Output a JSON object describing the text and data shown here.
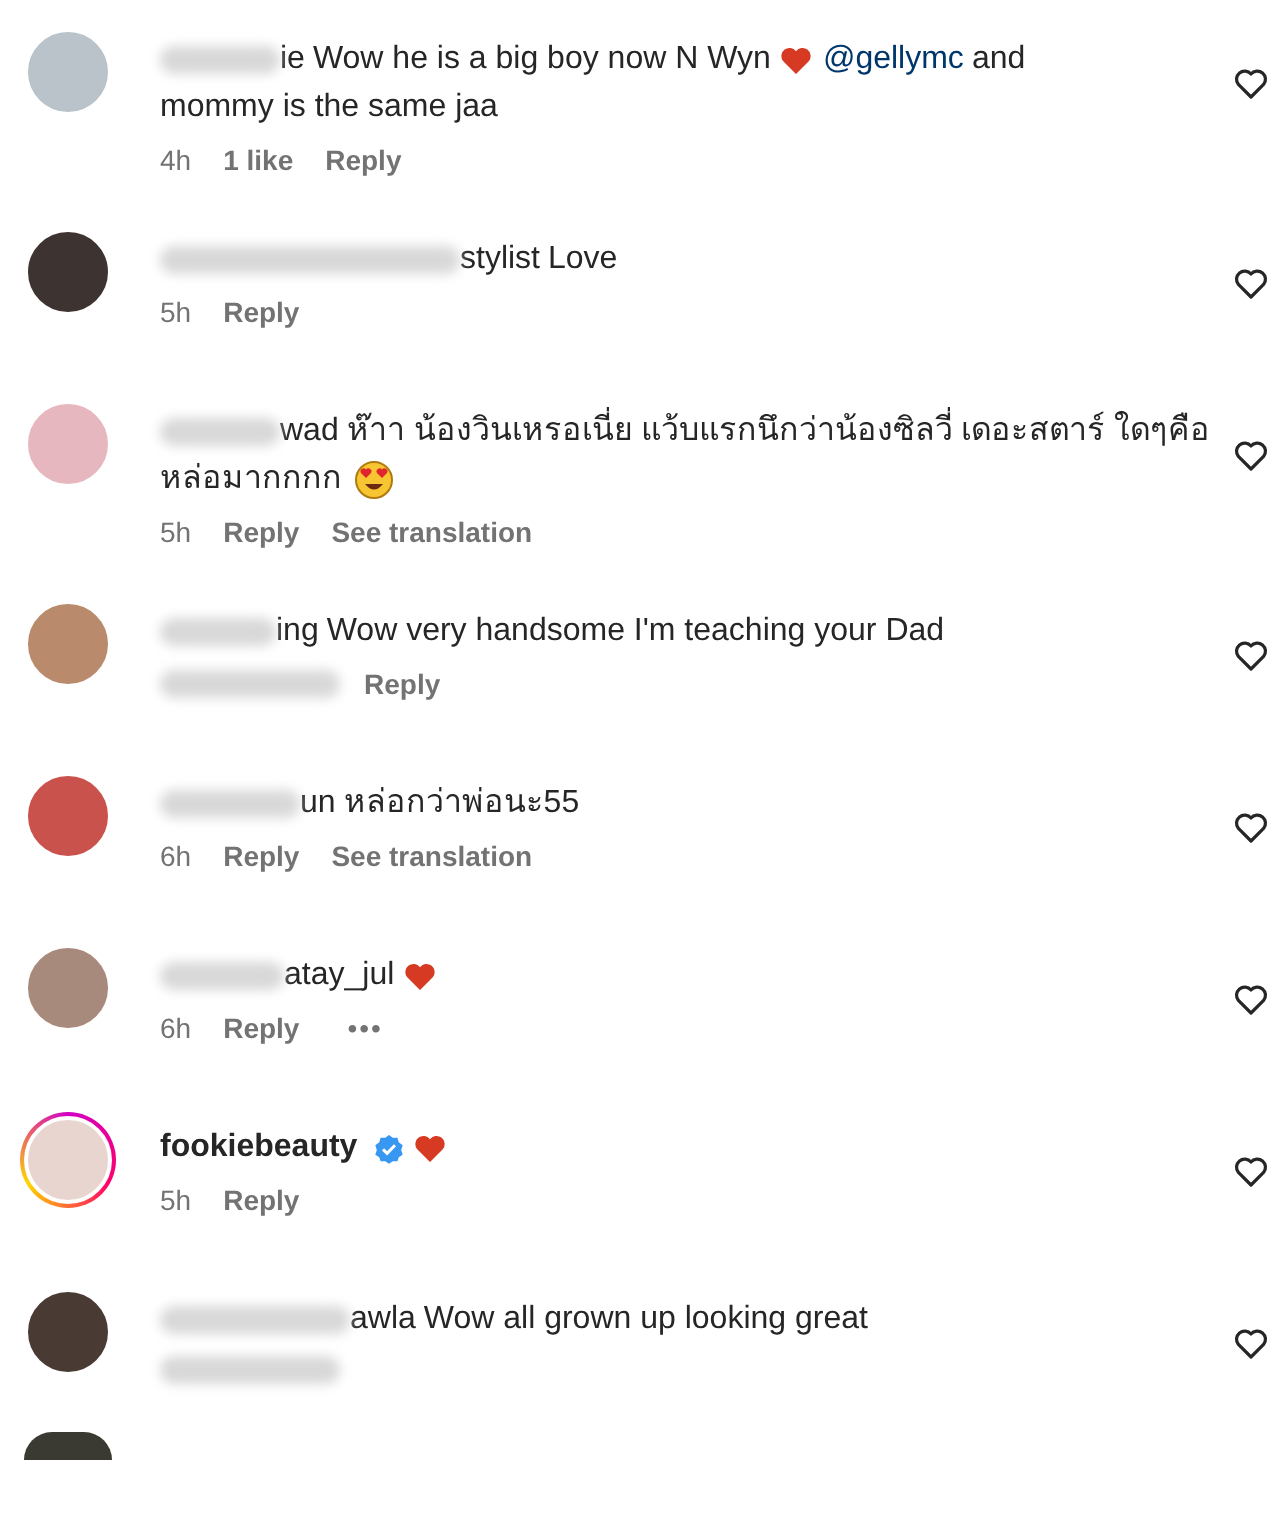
{
  "comments": [
    {
      "avatar": {
        "color": "#b9c3c9",
        "story_ring": false
      },
      "username": "ie",
      "username_blurred": true,
      "verified": false,
      "segments": [
        {
          "kind": "text",
          "text": "Wow he is a big boy now N Wyn"
        },
        {
          "kind": "heart"
        },
        {
          "kind": "mention",
          "text": "@gellymc"
        },
        {
          "kind": "text",
          "text": "and"
        },
        {
          "kind": "text",
          "text": "mommy is the same jaa"
        }
      ],
      "meta": [
        {
          "kind": "time",
          "text": "4h"
        },
        {
          "kind": "likes",
          "text": "1 like"
        },
        {
          "kind": "reply",
          "text": "Reply"
        }
      ]
    },
    {
      "avatar": {
        "color": "#3d3431",
        "story_ring": false
      },
      "username": "stylist",
      "username_blurred": true,
      "verified": false,
      "segments": [
        {
          "kind": "text",
          "text": "Love"
        }
      ],
      "meta": [
        {
          "kind": "time",
          "text": "5h"
        },
        {
          "kind": "reply",
          "text": "Reply"
        }
      ]
    },
    {
      "avatar": {
        "color": "#e7b7bf",
        "story_ring": false
      },
      "username": "wad",
      "username_blurred": true,
      "verified": false,
      "segments": [
        {
          "kind": "text",
          "text": "ห๊าา น้องวินเหรอเนี่ย แว้บแรกนึกว่าน้องซิลวี่ เดอะสตาร์ ใดๆคือ"
        },
        {
          "kind": "text",
          "text": "หล่อมากกกก"
        },
        {
          "kind": "smiley"
        }
      ],
      "meta": [
        {
          "kind": "time",
          "text": "5h"
        },
        {
          "kind": "reply",
          "text": "Reply"
        },
        {
          "kind": "translate",
          "text": "See translation"
        }
      ]
    },
    {
      "avatar": {
        "color": "#b98a6c",
        "story_ring": false
      },
      "username": "ing",
      "username_blurred": true,
      "verified": false,
      "segments": [
        {
          "kind": "text",
          "text": "Wow very handsome I'm teaching your Dad"
        }
      ],
      "meta": [
        {
          "kind": "blurred"
        },
        {
          "kind": "reply",
          "text": "Reply"
        }
      ]
    },
    {
      "avatar": {
        "color": "#c9524c",
        "story_ring": false
      },
      "username": "un",
      "username_blurred": true,
      "verified": false,
      "segments": [
        {
          "kind": "text",
          "text": "หล่อกว่าพ่อนะ55"
        }
      ],
      "meta": [
        {
          "kind": "time",
          "text": "6h"
        },
        {
          "kind": "reply",
          "text": "Reply"
        },
        {
          "kind": "translate",
          "text": "See translation"
        }
      ]
    },
    {
      "avatar": {
        "color": "#a88a7c",
        "story_ring": false
      },
      "username": "atay_jul",
      "username_blurred": true,
      "verified": false,
      "segments": [
        {
          "kind": "heart"
        }
      ],
      "meta": [
        {
          "kind": "time",
          "text": "6h"
        },
        {
          "kind": "reply",
          "text": "Reply"
        },
        {
          "kind": "more",
          "text": "•••"
        }
      ]
    },
    {
      "avatar": {
        "color": "#e8d5cf",
        "story_ring": true
      },
      "username": "fookiebeauty",
      "username_blurred": false,
      "verified": true,
      "segments": [
        {
          "kind": "heart"
        }
      ],
      "meta": [
        {
          "kind": "time",
          "text": "5h"
        },
        {
          "kind": "reply",
          "text": "Reply"
        }
      ]
    },
    {
      "avatar": {
        "color": "#4a3a34",
        "story_ring": false
      },
      "username": "awla",
      "username_blurred": true,
      "verified": false,
      "segments": [
        {
          "kind": "text",
          "text": "Wow all grown up looking great"
        }
      ],
      "meta": [
        {
          "kind": "blurred"
        }
      ]
    }
  ]
}
